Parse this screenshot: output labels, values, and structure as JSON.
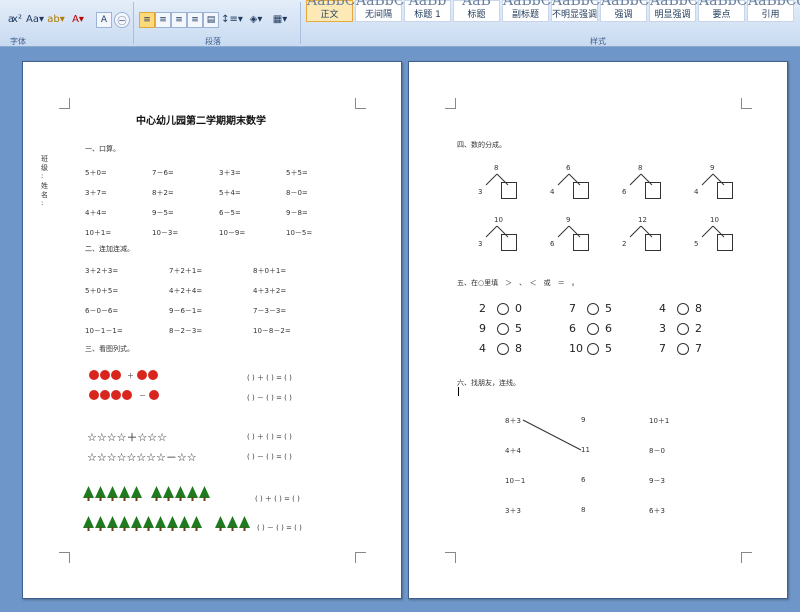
{
  "ribbon": {
    "font_group_label": "字体",
    "paragraph_group_label": "段落",
    "styles_group_label": "样式",
    "styles": [
      {
        "label": "正文",
        "sample": "AaBbCc",
        "active": true
      },
      {
        "label": "无间隔",
        "sample": "AaBbCc",
        "active": false
      },
      {
        "label": "标题 1",
        "sample": "AaBb",
        "active": false
      },
      {
        "label": "标题",
        "sample": "AaB",
        "active": false
      },
      {
        "label": "副标题",
        "sample": "AaBbCc",
        "active": false
      },
      {
        "label": "不明显强调",
        "sample": "AaBbCc",
        "active": false
      },
      {
        "label": "强调",
        "sample": "AaBbCc",
        "active": false
      },
      {
        "label": "明显强调",
        "sample": "AaBbCc",
        "active": false
      },
      {
        "label": "要点",
        "sample": "AaBbCc",
        "active": false
      },
      {
        "label": "引用",
        "sample": "AaBbCc",
        "active": false
      }
    ],
    "font_tools": [
      "Aa▾",
      "ab▾",
      "A▾",
      "A",
      "㊀"
    ],
    "accent_color": "#e8a93c"
  },
  "page1": {
    "title": "中心幼儿园第二学期期末数学",
    "side_labels": [
      "班",
      "级",
      ":",
      "姓",
      "名",
      ":"
    ],
    "section1": "一、口算。",
    "oral": [
      [
        "5＋0=",
        "7－6=",
        "3＋3=",
        "5＋5="
      ],
      [
        "3＋7=",
        "8＋2=",
        "5＋4=",
        "8－0="
      ],
      [
        "4＋4=",
        "9－5=",
        "6－5=",
        "9－8="
      ],
      [
        "10＋1=",
        "10－3=",
        "10－9=",
        "10－5="
      ]
    ],
    "section2": "二、连加连减。",
    "chain": [
      [
        "3＋2＋3=",
        "7＋2＋1=",
        "8＋0＋1="
      ],
      [
        "5＋0＋5=",
        "4＋2＋4=",
        "4＋3＋2="
      ],
      [
        "6－0－6=",
        "9－6－1=",
        "7－3－3="
      ],
      [
        "10－1－1=",
        "8－2－3=",
        "10－8－2="
      ]
    ],
    "section3": "三、看图列式。",
    "eq_plus": "(    ) ＋ (    ) = (    )",
    "eq_minus": "(    ) － (    ) = (    )",
    "apple_row1_ops": "＋",
    "apple_row2_ops": "－",
    "star_row1": "☆☆☆☆＋☆☆☆",
    "star_row2": "☆☆☆☆☆☆☆☆－☆☆",
    "apple_color": "#d8261e"
  },
  "page2": {
    "section4": "四、数的分成。",
    "splits_row1": [
      "8",
      "6",
      "8",
      "9"
    ],
    "splits_row1_left": [
      "3",
      "4",
      "6",
      "4"
    ],
    "splits_row2": [
      "10",
      "9",
      "12",
      "10"
    ],
    "splits_row2_left": [
      "3",
      "6",
      "2",
      "5"
    ],
    "section5": "五、在○里填　＞　、　＜　或　＝　。",
    "compare": [
      [
        [
          "2",
          "0"
        ],
        [
          "7",
          "5"
        ],
        [
          "4",
          "8"
        ]
      ],
      [
        [
          "9",
          "5"
        ],
        [
          "6",
          "6"
        ],
        [
          "3",
          "2"
        ]
      ],
      [
        [
          "4",
          "8"
        ],
        [
          "10",
          "5"
        ],
        [
          "7",
          "7"
        ]
      ]
    ],
    "section6": "六、找朋友，连线。",
    "match": [
      [
        "8＋3",
        "9",
        "10＋1"
      ],
      [
        "4＋4",
        "11",
        "8－0"
      ],
      [
        "10－1",
        "6",
        "9－3"
      ],
      [
        "3＋3",
        "8",
        "6＋3"
      ]
    ]
  }
}
